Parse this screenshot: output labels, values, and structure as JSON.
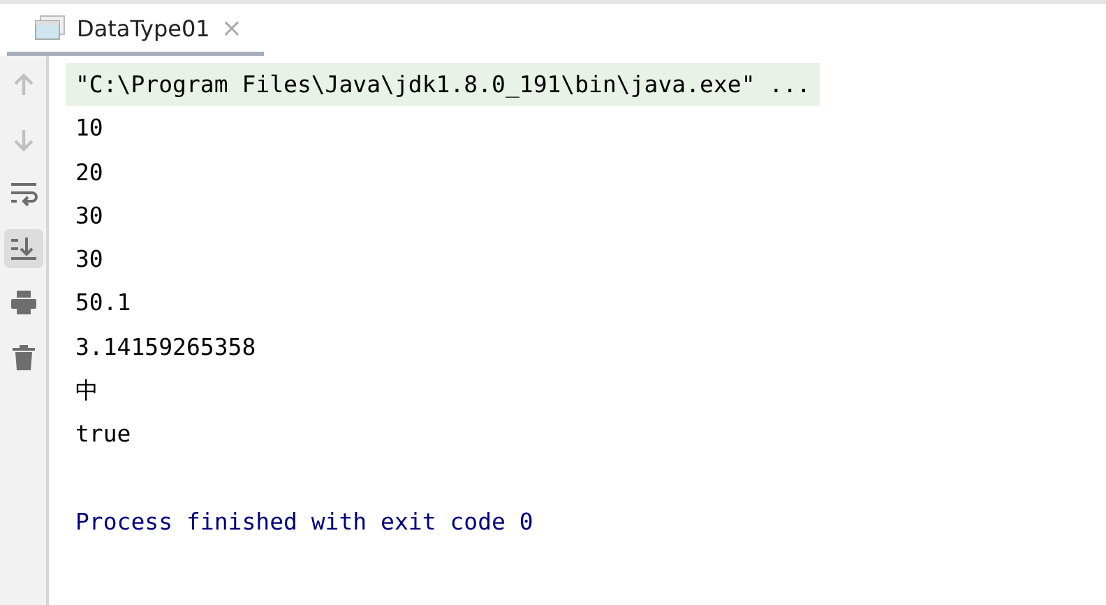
{
  "tabs": [
    {
      "label": "DataType01",
      "close": "×",
      "selected": true
    }
  ],
  "toolbar": [
    {
      "kind": "up",
      "disabled": true,
      "selected": false
    },
    {
      "kind": "down",
      "disabled": true,
      "selected": false
    },
    {
      "kind": "wrap",
      "disabled": false,
      "selected": false
    },
    {
      "kind": "scroll",
      "disabled": false,
      "selected": true
    },
    {
      "kind": "print",
      "disabled": false,
      "selected": false
    },
    {
      "kind": "trash",
      "disabled": false,
      "selected": false
    }
  ],
  "console": [
    {
      "kind": "command",
      "text": "\"C:\\Program Files\\Java\\jdk1.8.0_191\\bin\\java.exe\" ..."
    },
    {
      "kind": "stdout",
      "text": "10"
    },
    {
      "kind": "stdout",
      "text": "20"
    },
    {
      "kind": "stdout",
      "text": "30"
    },
    {
      "kind": "stdout",
      "text": "30"
    },
    {
      "kind": "stdout",
      "text": "50.1"
    },
    {
      "kind": "stdout",
      "text": "3.14159265358"
    },
    {
      "kind": "stdout",
      "text": "中"
    },
    {
      "kind": "stdout",
      "text": "true"
    },
    {
      "kind": "exit",
      "text": "Process finished with exit code 0"
    }
  ]
}
